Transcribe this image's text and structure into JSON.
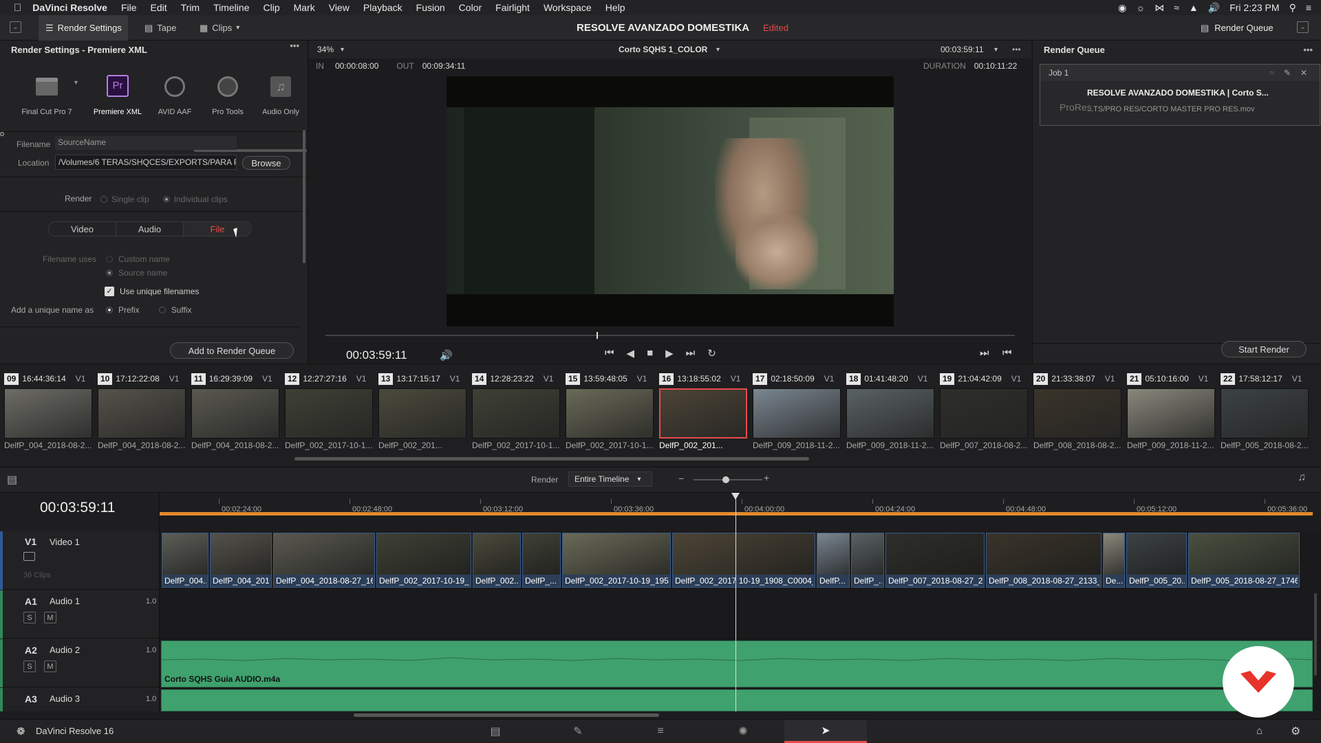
{
  "menubar": {
    "app_name": "DaVinci Resolve",
    "menus": [
      "File",
      "Edit",
      "Trim",
      "Timeline",
      "Clip",
      "Mark",
      "View",
      "Playback",
      "Fusion",
      "Color",
      "Fairlight",
      "Workspace",
      "Help"
    ],
    "clock": "Fri 2:23 PM"
  },
  "toolbar": {
    "render_settings": "Render Settings",
    "tape": "Tape",
    "clips": "Clips",
    "project_title": "RESOLVE AVANZADO DOMESTIKA",
    "edited": "Edited",
    "render_queue": "Render Queue"
  },
  "render_settings": {
    "title": "Render Settings - Premiere XML",
    "presets": [
      {
        "label": "o"
      },
      {
        "label": "Final Cut Pro 7"
      },
      {
        "label": "Premiere XML"
      },
      {
        "label": "AVID AAF"
      },
      {
        "label": "Pro Tools"
      },
      {
        "label": "Audio Only"
      }
    ],
    "filename_label": "Filename",
    "filename_value": "SourceName",
    "location_label": "Location",
    "location_value": "/Volumes/6 TERAS/SHQCES/EXPORTS/PARA PR",
    "browse": "Browse",
    "render_label": "Render",
    "single_clip": "Single clip",
    "individual_clips": "Individual clips",
    "tabs": [
      "Video",
      "Audio",
      "File"
    ],
    "filename_uses": "Filename uses",
    "custom_name": "Custom name",
    "source_name": "Source name",
    "use_unique": "Use unique filenames",
    "add_unique": "Add a unique name as",
    "prefix": "Prefix",
    "suffix": "Suffix",
    "add_to_queue": "Add to Render Queue"
  },
  "viewer": {
    "zoom": "34%",
    "clip_name": "Corto SQHS 1_COLOR",
    "timecode_top": "00:03:59:11",
    "in_label": "IN",
    "in_value": "00:00:08:00",
    "out_label": "OUT",
    "out_value": "00:09:34:11",
    "duration_label": "DURATION",
    "duration_value": "00:10:11:22",
    "timecode": "00:03:59:11",
    "playhead_fraction": 0.395
  },
  "render_queue": {
    "title": "Render Queue",
    "job_label": "Job 1",
    "job_codec": "ProRes",
    "job_title": "RESOLVE AVANZADO DOMESTIKA | Corto S...",
    "job_path": "...TS/PRO RES/CORTO MASTER PRO RES.mov",
    "start_render": "Start Render"
  },
  "clips": [
    {
      "num": "09",
      "tc": "16:44:36:14",
      "track": "V1",
      "name": "DelfP_004_2018-08-2...",
      "color": "#6d6c66"
    },
    {
      "num": "10",
      "tc": "17:12:22:08",
      "track": "V1",
      "name": "DelfP_004_2018-08-2...",
      "color": "#55524a"
    },
    {
      "num": "11",
      "tc": "16:29:39:09",
      "track": "V1",
      "name": "DelfP_004_2018-08-2...",
      "color": "#5a5950"
    },
    {
      "num": "12",
      "tc": "12:27:27:16",
      "track": "V1",
      "name": "DelfP_002_2017-10-1...",
      "color": "#3f4034"
    },
    {
      "num": "13",
      "tc": "13:17:15:17",
      "track": "V1",
      "name": "DelfP_002_201...",
      "color": "#4a4a3c"
    },
    {
      "num": "14",
      "tc": "12:28:23:22",
      "track": "V1",
      "name": "DelfP_002_2017-10-1...",
      "color": "#3f4034"
    },
    {
      "num": "15",
      "tc": "13:59:48:05",
      "track": "V1",
      "name": "DelfP_002_2017-10-1...",
      "color": "#6a6a58"
    },
    {
      "num": "16",
      "tc": "13:18:55:02",
      "track": "V1",
      "name": "DelfP_002_201...",
      "color": "#4c4436"
    },
    {
      "num": "17",
      "tc": "02:18:50:09",
      "track": "V1",
      "name": "DelfP_009_2018-11-2...",
      "color": "#7a8690"
    },
    {
      "num": "18",
      "tc": "01:41:48:20",
      "track": "V1",
      "name": "DelfP_009_2018-11-2...",
      "color": "#5a6264"
    },
    {
      "num": "19",
      "tc": "21:04:42:09",
      "track": "V1",
      "name": "DelfP_007_2018-08-2...",
      "color": "#2e2e2a"
    },
    {
      "num": "20",
      "tc": "21:33:38:07",
      "track": "V1",
      "name": "DelfP_008_2018-08-2...",
      "color": "#3a342a"
    },
    {
      "num": "21",
      "tc": "05:10:16:00",
      "track": "V1",
      "name": "DelfP_009_2018-11-2...",
      "color": "#8a887c"
    },
    {
      "num": "22",
      "tc": "17:58:12:17",
      "track": "V1",
      "name": "DelfP_005_2018-08-2...",
      "color": "#3c4244"
    }
  ],
  "timeline": {
    "render_label": "Render",
    "render_option": "Entire Timeline",
    "timecode": "00:03:59:11",
    "ruler": [
      "00:02:24:00",
      "00:02:48:00",
      "00:03:12:00",
      "00:03:36:00",
      "00:04:00:00",
      "00:04:24:00",
      "00:04:48:00",
      "00:05:12:00",
      "00:05:36:00"
    ],
    "v1_label": "V1",
    "v1_name": "Video 1",
    "v1_clips_count": "36 Clips",
    "a1_label": "A1",
    "a1_name": "Audio 1",
    "a1_level": "1.0",
    "a2_label": "A2",
    "a2_name": "Audio 2",
    "a2_level": "1.0",
    "a2_clip": "Corto SQHS Guia AUDIO.m4a",
    "a3_label": "A3",
    "a3_name": "Audio 3",
    "a3_level": "1.0",
    "solo": "S",
    "mute": "M",
    "video_clips": [
      {
        "label": "DelfP_004...",
        "color": "#5e5e58"
      },
      {
        "label": "DelfP_004_201...",
        "color": "#54524a"
      },
      {
        "label": "DelfP_004_2018-08-27_16...",
        "color": "#5a5950"
      },
      {
        "label": "DelfP_002_2017-10-19_1...",
        "color": "#3f4034"
      },
      {
        "label": "DelfP_002...",
        "color": "#4a4a3c"
      },
      {
        "label": "DelfP_...",
        "color": "#3f4034"
      },
      {
        "label": "DelfP_002_2017-10-19_1951...",
        "color": "#6a6a58"
      },
      {
        "label": "DelfP_002_2017 10-19_1908_C0004_[0...",
        "color": "#4c4436"
      },
      {
        "label": "DelfP...",
        "color": "#7a8690"
      },
      {
        "label": "DelfP_...",
        "color": "#5a6264"
      },
      {
        "label": "DelfP_007_2018-08-27_21...",
        "color": "#2e2e2a"
      },
      {
        "label": "DelfP_008_2018-08-27_2133_...",
        "color": "#3a342a"
      },
      {
        "label": "De...",
        "color": "#8a887c"
      },
      {
        "label": "DelfP_005_20...",
        "color": "#3c4244"
      },
      {
        "label": "DelfP_005_2018-08-27_1746_...",
        "color": "#4a5040"
      }
    ]
  },
  "bottombar": {
    "app_label": "DaVinci Resolve 16"
  },
  "colors": {
    "accent_red": "#e64b4b",
    "timeline_orange": "#e08a2c",
    "audio_green": "#3fa16e",
    "video_blue": "#2c3e57"
  }
}
